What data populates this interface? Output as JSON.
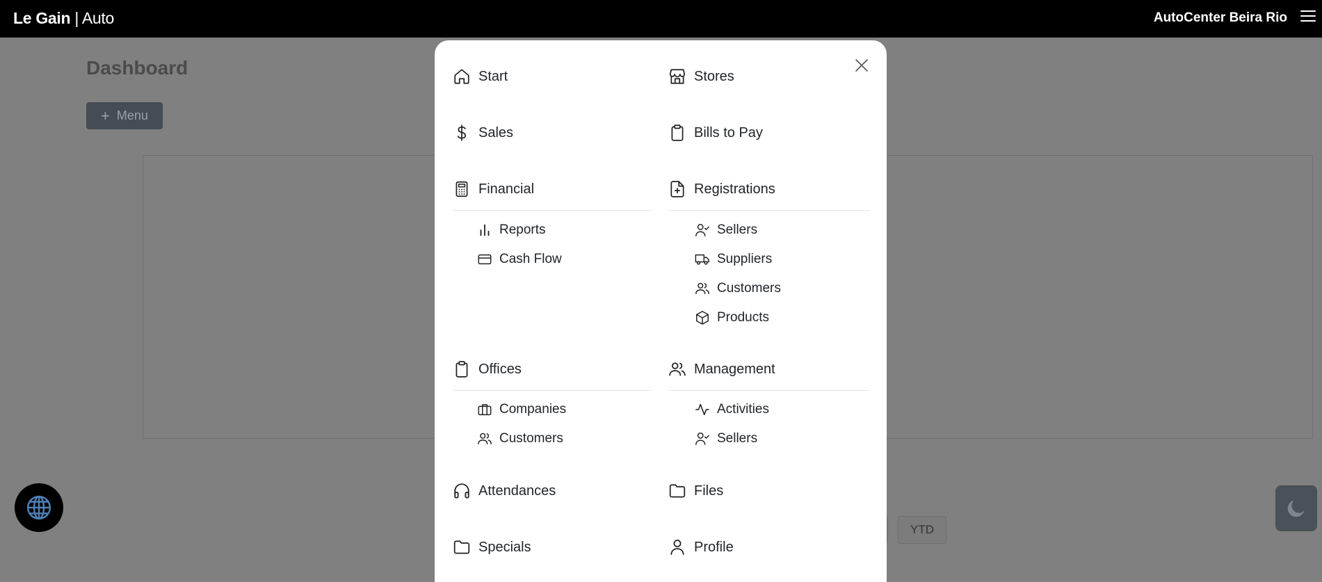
{
  "header": {
    "brand_bold": "Le Gain",
    "brand_light": "| Auto",
    "store_name": "AutoCenter Beira Rio"
  },
  "page": {
    "title": "Dashboard",
    "menu_button": "Menu",
    "period_visible": "YTD"
  },
  "menu": {
    "start": "Start",
    "stores": "Stores",
    "sales": "Sales",
    "bills_to_pay": "Bills to Pay",
    "financial": {
      "label": "Financial",
      "children": {
        "reports": "Reports",
        "cash_flow": "Cash Flow"
      }
    },
    "registrations": {
      "label": "Registrations",
      "children": {
        "sellers": "Sellers",
        "suppliers": "Suppliers",
        "customers": "Customers",
        "products": "Products"
      }
    },
    "offices": {
      "label": "Offices",
      "children": {
        "companies": "Companies",
        "customers": "Customers"
      }
    },
    "management": {
      "label": "Management",
      "children": {
        "activities": "Activities",
        "sellers": "Sellers"
      }
    },
    "attendances": "Attendances",
    "files": "Files",
    "specials": "Specials",
    "profile": "Profile"
  },
  "icons": {
    "start": "home-icon",
    "stores": "shop-icon",
    "sales": "dollar-icon",
    "bills_to_pay": "clipboard-icon",
    "financial": "calculator-icon",
    "reports": "bar-chart-icon",
    "cash_flow": "credit-card-icon",
    "registrations": "file-plus-icon",
    "sellers": "person-check-icon",
    "suppliers": "truck-icon",
    "customers": "people-icon",
    "products": "box-icon",
    "offices": "clipboard-icon",
    "companies": "briefcase-icon",
    "management": "people-icon",
    "activities": "activity-icon",
    "attendances": "headphones-icon",
    "files": "folder-icon",
    "specials": "folder-icon",
    "profile": "person-icon"
  },
  "colors": {
    "topbar": "#000000",
    "overlay": "#808080",
    "modal": "#ffffff",
    "text": "#212529"
  }
}
